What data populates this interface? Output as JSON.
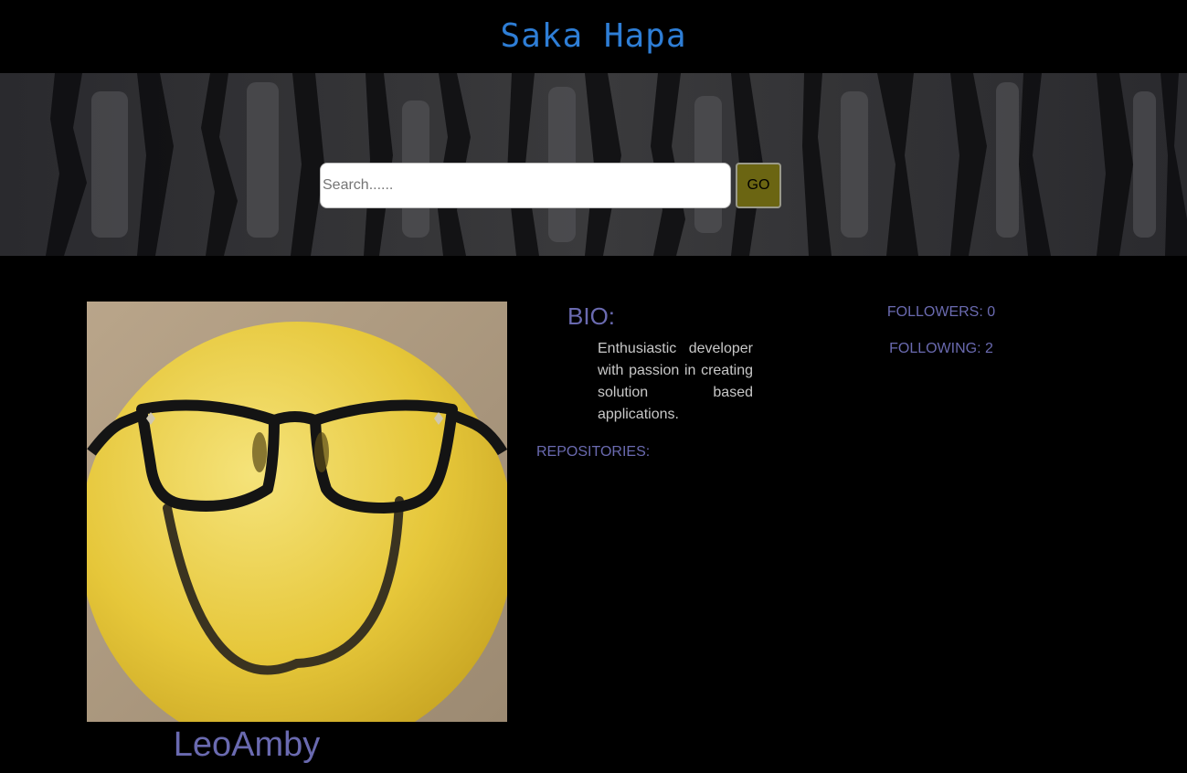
{
  "header": {
    "title": "Saka Hapa"
  },
  "search": {
    "placeholder": "Search......",
    "value": "",
    "button_label": "GO"
  },
  "profile": {
    "username": "LeoAmby",
    "avatar_icon": "smiley-balloon-with-glasses",
    "bio_title": "BIO:",
    "bio": "Enthusiastic developer with passion in creating solution based applications.",
    "repositories_label": "REPOSITORIES:",
    "followers_label": "FOLLOWERS: 0",
    "following_label": "FOLLOWING: 2"
  },
  "colors": {
    "brand": "#2e7ed6",
    "accent_text": "#6a6ab0",
    "go_button": "#6b6512",
    "background": "#000000"
  }
}
